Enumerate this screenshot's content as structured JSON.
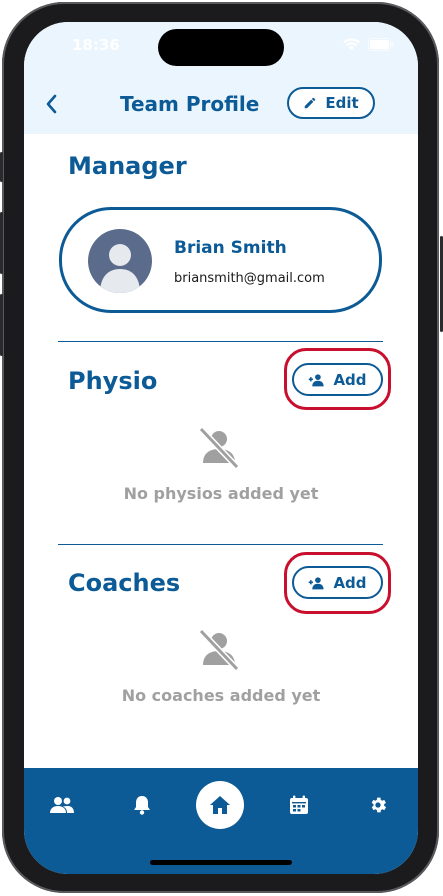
{
  "status_bar": {
    "time": "18:36"
  },
  "header": {
    "title": "Team Profile",
    "edit_label": "Edit"
  },
  "manager": {
    "section_title": "Manager",
    "name": "Brian Smith",
    "email": "briansmith@gmail.com"
  },
  "physio": {
    "section_title": "Physio",
    "add_label": "Add",
    "empty_text": "No physios added yet"
  },
  "coaches": {
    "section_title": "Coaches",
    "add_label": "Add",
    "empty_text": "No coaches added yet"
  },
  "tab_bar": {
    "tabs": [
      "people-icon",
      "bell-icon",
      "home-icon",
      "calendar-icon",
      "gear-icon"
    ],
    "active": "home-icon"
  },
  "colors": {
    "primary": "#0c5a96",
    "highlight": "#c8102e",
    "muted": "#a0a0a0"
  }
}
